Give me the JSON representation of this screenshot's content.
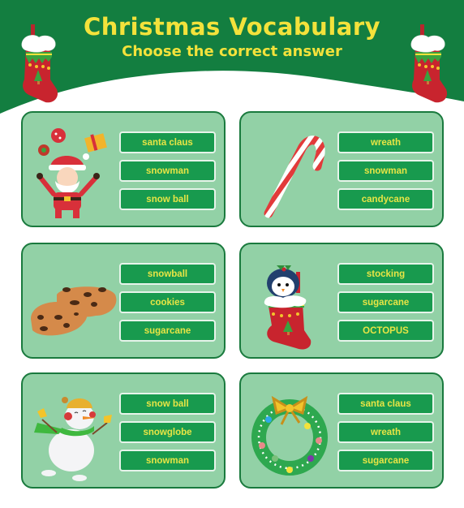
{
  "header": {
    "title": "Christmas Vocabulary",
    "subtitle": "Choose the correct answer"
  },
  "colors": {
    "header_green": "#137e40",
    "card_bg": "#92d1a6",
    "card_border": "#1a7a3e",
    "option_bg": "#189a4e",
    "option_text": "#e8e545",
    "title_text": "#f3e23b"
  },
  "questions": [
    {
      "picture": "santa-claus",
      "options": [
        "santa claus",
        "snowman",
        "snow ball"
      ]
    },
    {
      "picture": "candy-cane",
      "options": [
        "wreath",
        "snowman",
        "candycane"
      ]
    },
    {
      "picture": "cookies",
      "options": [
        "snowball",
        "cookies",
        "sugarcane"
      ]
    },
    {
      "picture": "stocking-with-penguin",
      "options": [
        "stocking",
        "sugarcane",
        "OCTOPUS"
      ]
    },
    {
      "picture": "snowman",
      "options": [
        "snow ball",
        "snowglobe",
        "snowman"
      ]
    },
    {
      "picture": "wreath",
      "options": [
        "santa claus",
        "wreath",
        "sugarcane"
      ]
    }
  ]
}
